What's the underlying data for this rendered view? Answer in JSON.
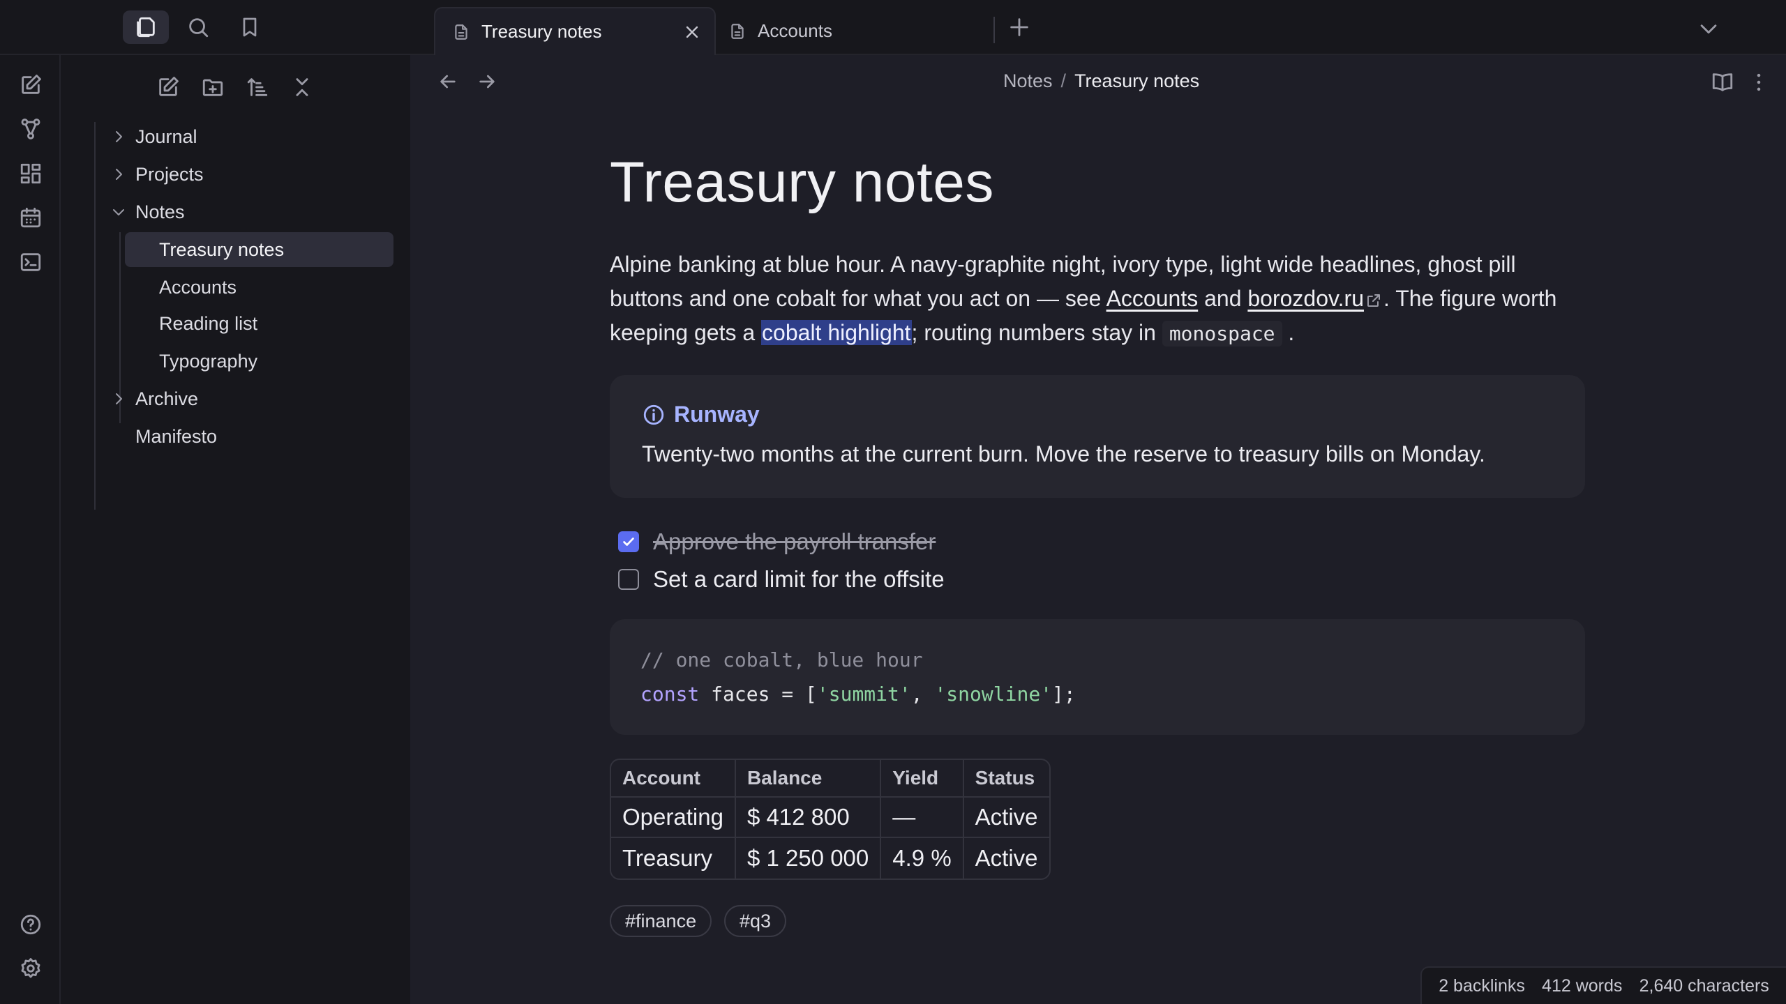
{
  "colors": {
    "background": "#1e1e27",
    "chrome": "#17171c",
    "accent": "#5b6cf0",
    "callout_title": "#a7b4ff",
    "highlight": "#2f3f8a"
  },
  "titlebar": {
    "left_buttons": [
      {
        "icon": "files-icon",
        "active": true
      },
      {
        "icon": "search-icon",
        "active": false
      },
      {
        "icon": "bookmark-icon",
        "active": false
      }
    ],
    "tabs": [
      {
        "label": "Treasury notes",
        "active": true,
        "icon": "document-icon"
      },
      {
        "label": "Accounts",
        "active": false,
        "icon": "document-icon"
      }
    ],
    "new_tab_icon": "plus-icon",
    "tab_list_icon": "chevron-down-icon"
  },
  "ribbon": {
    "top": [
      "new-note-icon",
      "graph-icon",
      "canvas-icon",
      "calendar-icon",
      "terminal-icon"
    ],
    "bottom": [
      "help-icon",
      "settings-icon"
    ]
  },
  "sidebar": {
    "toolbar": [
      "new-note-icon",
      "new-folder-icon",
      "sort-icon",
      "collapse-all-icon"
    ],
    "tree": [
      {
        "label": "Journal",
        "type": "folder",
        "expanded": false
      },
      {
        "label": "Projects",
        "type": "folder",
        "expanded": false
      },
      {
        "label": "Notes",
        "type": "folder",
        "expanded": true
      },
      {
        "label": "Treasury notes",
        "type": "file",
        "selected": true
      },
      {
        "label": "Accounts",
        "type": "file"
      },
      {
        "label": "Reading list",
        "type": "file"
      },
      {
        "label": "Typography",
        "type": "file"
      },
      {
        "label": "Archive",
        "type": "folder",
        "expanded": false
      },
      {
        "label": "Manifesto",
        "type": "file"
      }
    ]
  },
  "header": {
    "breadcrumb": [
      "Notes",
      "Treasury notes"
    ],
    "separator": "/",
    "right_icons": [
      "reading-view-icon",
      "more-options-icon"
    ]
  },
  "note": {
    "title": "Treasury notes",
    "intro": {
      "part1": "Alpine banking at blue hour. A navy-graphite night, ivory type, light wide headlines, ghost pill buttons and one cobalt for what you act on — see ",
      "link1": "Accounts",
      "part2": " and ",
      "link2": "borozdov.ru",
      "part3": ". The figure worth keeping gets a ",
      "highlight": "cobalt highlight",
      "part4": "; routing numbers stay in ",
      "code": "monospace",
      "part5": "."
    },
    "callout": {
      "title": "Runway",
      "body": "Twenty-two months at the current burn. Move the reserve to treasury bills on Monday."
    },
    "tasks": [
      {
        "text": "Approve the payroll transfer",
        "done": true
      },
      {
        "text": "Set a card limit for the offsite",
        "done": false
      }
    ],
    "code": {
      "comment": "// one cobalt, blue hour",
      "keyword": "const",
      "rest_a": " faces = [",
      "str1": "'summit'",
      "comma": ", ",
      "str2": "'snowline'",
      "rest_b": "];"
    },
    "table": {
      "headers": [
        "Account",
        "Balance",
        "Yield",
        "Status"
      ],
      "rows": [
        [
          "Operating",
          "$ 412 800",
          "—",
          "Active"
        ],
        [
          "Treasury",
          "$ 1 250 000",
          "4.9 %",
          "Active"
        ]
      ]
    },
    "tags": [
      "#finance",
      "#q3"
    ]
  },
  "status": {
    "backlinks": "2 backlinks",
    "words": "412 words",
    "characters": "2,640 characters"
  }
}
